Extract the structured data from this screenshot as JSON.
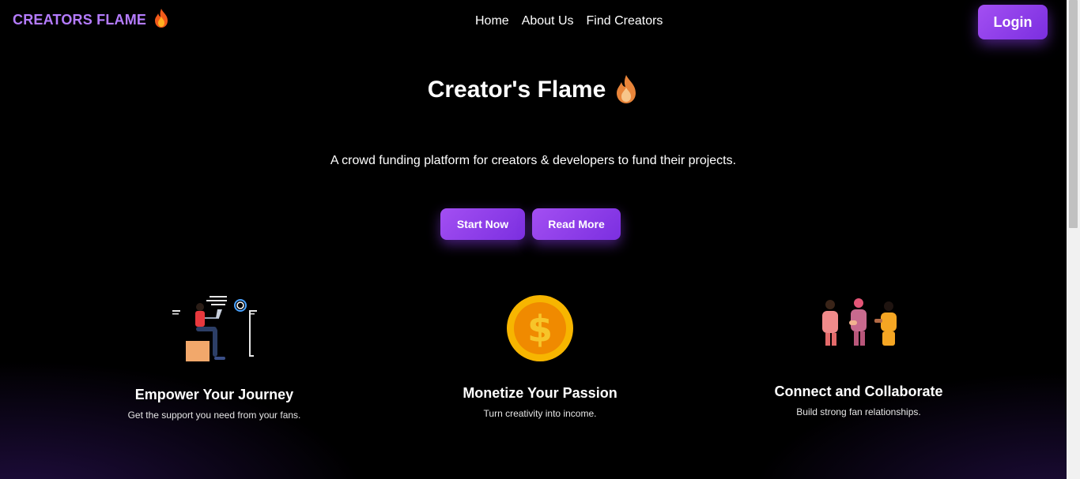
{
  "nav": {
    "brand": "CREATORS FLAME",
    "brand_icon": "flame-icon",
    "links": [
      "Home",
      "About Us",
      "Find Creators"
    ],
    "login_label": "Login"
  },
  "hero": {
    "title": "Creator's Flame",
    "title_icon": "flame-icon",
    "tagline": "A crowd funding platform for creators & developers to fund their projects.",
    "start_label": "Start Now",
    "read_label": "Read More"
  },
  "features": [
    {
      "title": "Empower Your Journey",
      "text": "Get the support you need from your fans.",
      "icon": "person-laptop-illustration"
    },
    {
      "title": "Monetize Your Passion",
      "text": "Turn creativity into income.",
      "icon": "dollar-coin-icon"
    },
    {
      "title": "Connect and Collaborate",
      "text": "Build strong fan relationships.",
      "icon": "people-group-illustration"
    }
  ],
  "colors": {
    "accent": "#9b45f0",
    "brand_text": "#b57cff",
    "background": "#000000"
  }
}
